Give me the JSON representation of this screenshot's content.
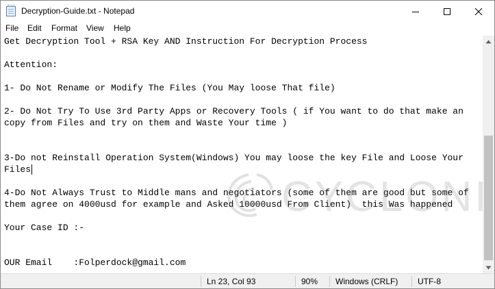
{
  "window": {
    "title": "Decryption-Guide.txt - Notepad",
    "icon": "notepad-icon"
  },
  "controls": {
    "minimize_icon": "minimize-icon",
    "maximize_icon": "maximize-icon",
    "close_icon": "close-icon"
  },
  "menu": {
    "items": [
      "File",
      "Edit",
      "Format",
      "View",
      "Help"
    ]
  },
  "editor": {
    "lines": [
      "Get Decryption Tool + RSA Key AND Instruction For Decryption Process",
      "",
      "Attention:",
      "",
      "1- Do Not Rename or Modify The Files (You May loose That file)",
      "",
      "2- Do Not Try To Use 3rd Party Apps or Recovery Tools ( if You want to do that make an",
      "copy from Files and try on them and Waste Your time )",
      "",
      "",
      "3-Do not Reinstall Operation System(Windows) You may loose the key File and Loose Your",
      "Files",
      "",
      "4-Do Not Always Trust to Middle mans and negotiators (some of them are good but some of",
      "them agree on 4000usd for example and Asked 10000usd From Client)  this Was happened",
      "",
      "Your Case ID :-",
      "",
      "",
      "OUR Email    :Folperdock@gmail.com"
    ]
  },
  "watermark": {
    "text": "CYCLONIS"
  },
  "scrollbar": {
    "position_fraction": 0.52
  },
  "status": {
    "position": "Ln 23, Col 93",
    "zoom": "90%",
    "line_ending": "Windows (CRLF)",
    "encoding": "UTF-8"
  }
}
